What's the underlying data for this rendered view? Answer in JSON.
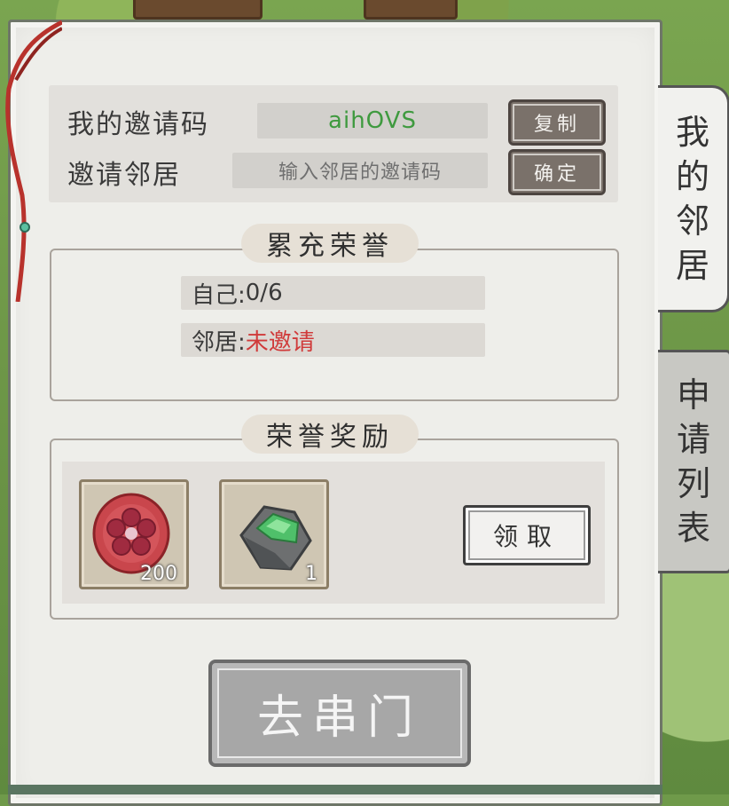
{
  "invite": {
    "my_code_label": "我的邀请码",
    "my_code_value": "aihOVS",
    "copy_button": "复制",
    "neighbor_label": "邀请邻居",
    "neighbor_placeholder": "输入邻居的邀请码",
    "confirm_button": "确定"
  },
  "honor": {
    "title": "累充荣誉",
    "self_label": "自己:",
    "self_value": "0/6",
    "neighbor_label": "邻居:",
    "neighbor_value": "未邀请"
  },
  "rewards": {
    "title": "荣誉奖励",
    "items": [
      {
        "icon": "plum-blossom-token-icon",
        "qty": "200"
      },
      {
        "icon": "jade-stone-icon",
        "qty": "1"
      }
    ],
    "claim_button": "领取"
  },
  "go_button": "去串门",
  "tabs": {
    "my_neighbors": [
      "我",
      "的",
      "邻",
      "居"
    ],
    "apply_list": [
      "申",
      "请",
      "列",
      "表"
    ]
  },
  "colors": {
    "code_text": "#3f9a3f",
    "uninvited_text": "#d03a3a"
  }
}
